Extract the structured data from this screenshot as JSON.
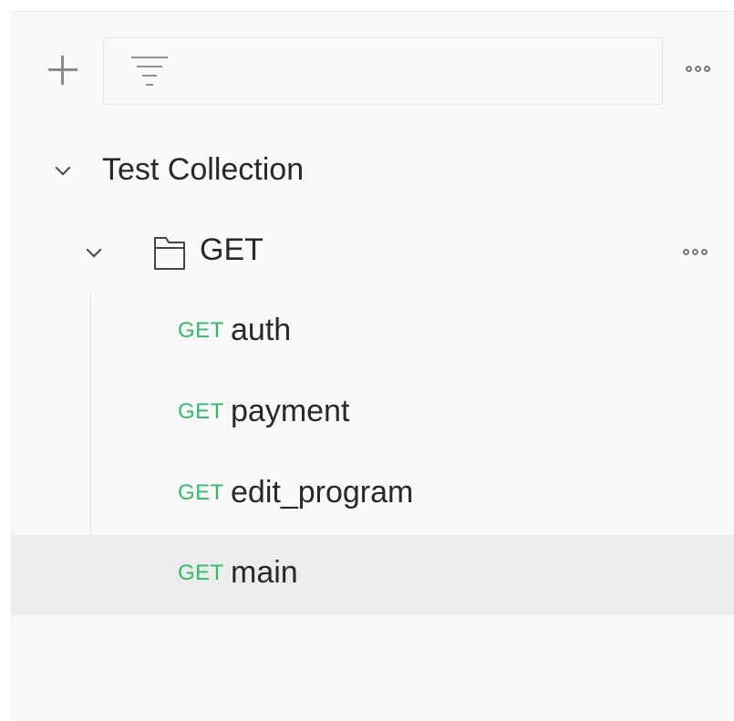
{
  "toolbar": {
    "add_icon": "plus-icon",
    "filter_icon": "filter-icon",
    "filter_placeholder": "",
    "filter_value": "",
    "more_icon": "more-horizontal-icon"
  },
  "collection": {
    "name": "Test Collection",
    "expanded": true,
    "folders": [
      {
        "name": "GET",
        "icon": "folder-icon",
        "expanded": true,
        "requests": [
          {
            "method": "GET",
            "name": "auth",
            "selected": false
          },
          {
            "method": "GET",
            "name": "payment",
            "selected": false
          },
          {
            "method": "GET",
            "name": "edit_program",
            "selected": false
          },
          {
            "method": "GET",
            "name": "main",
            "selected": true
          }
        ]
      }
    ]
  },
  "colors": {
    "method_get": "#2ebd6a",
    "selected_row": "#ececec",
    "panel_bg": "#f9f9f9",
    "text": "#282828"
  }
}
